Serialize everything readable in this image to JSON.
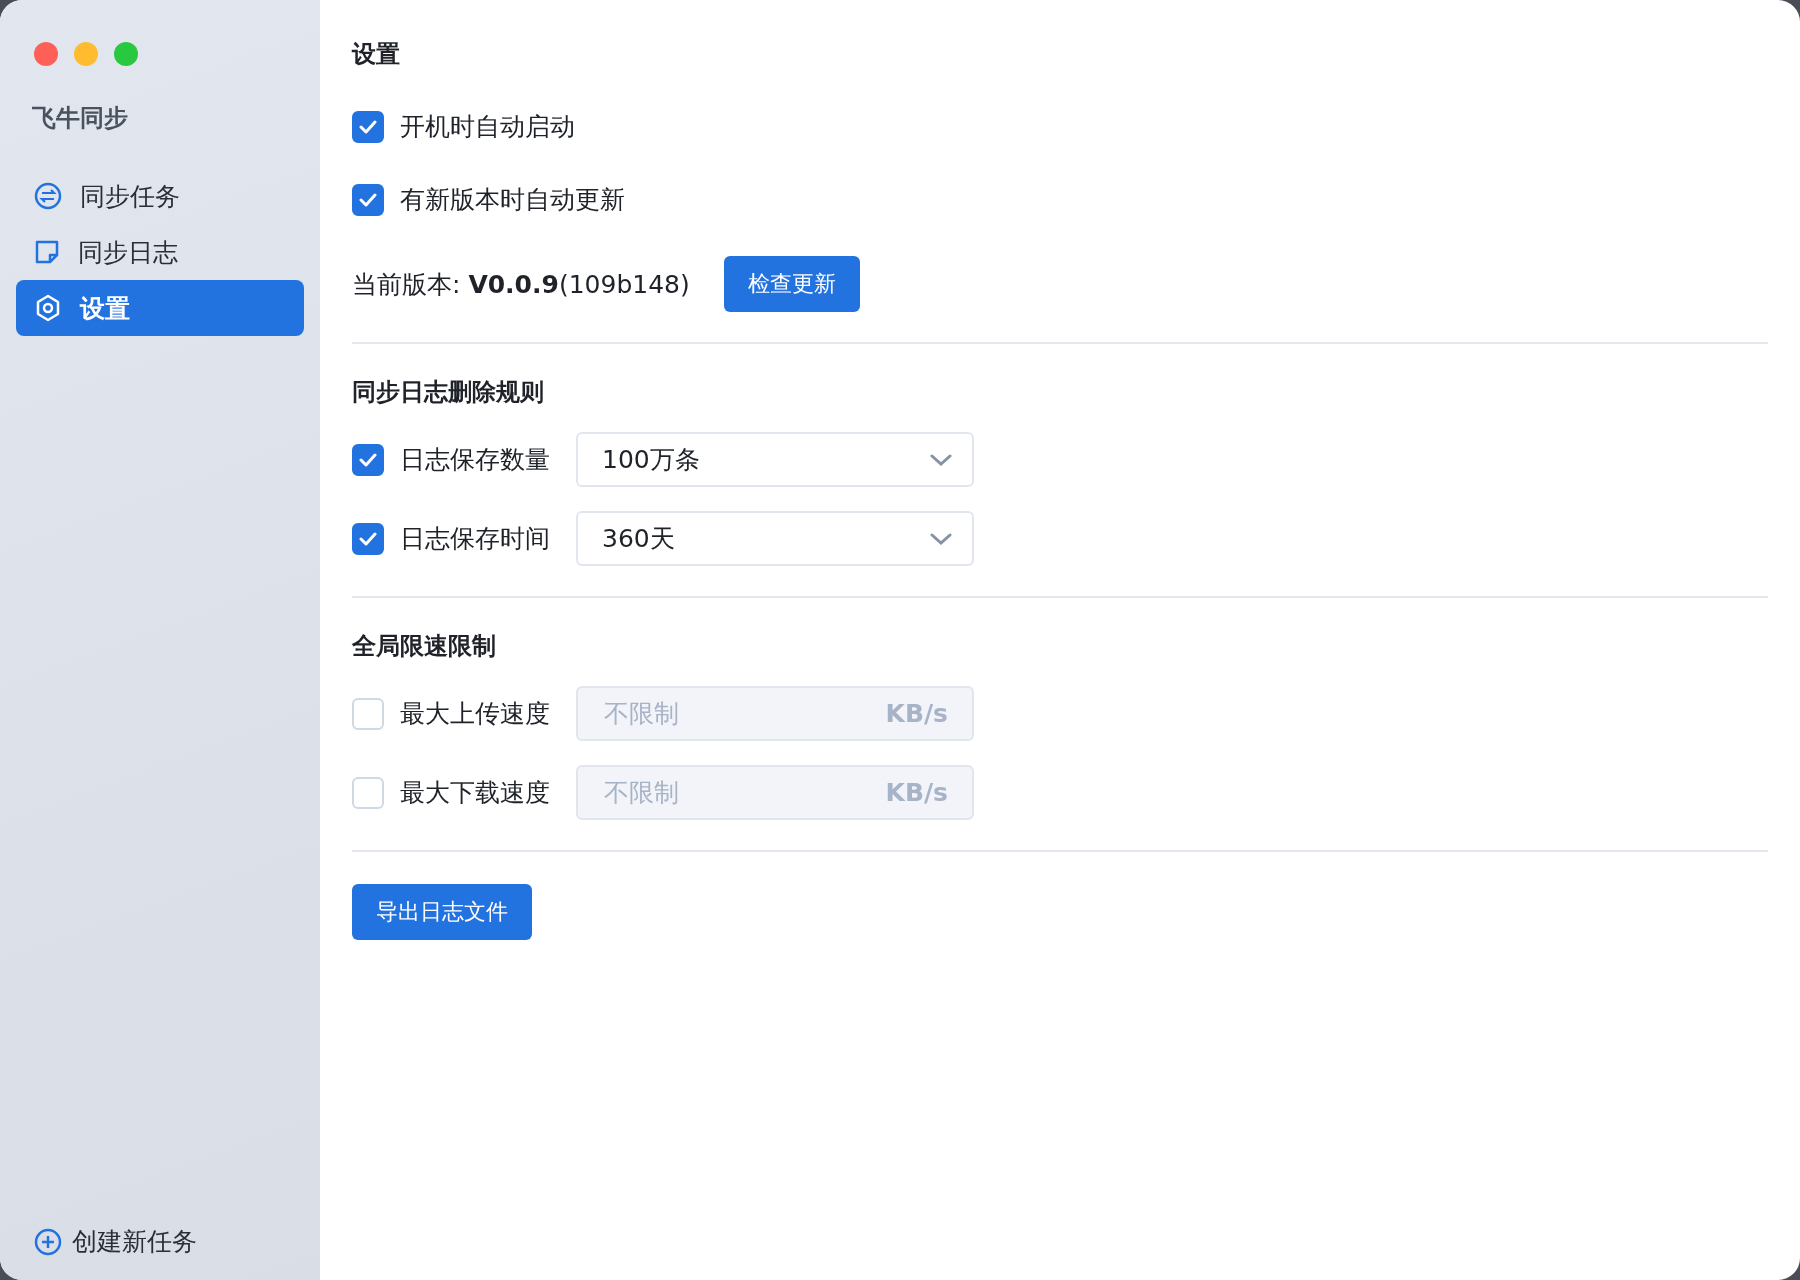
{
  "sidebar": {
    "app_name": "飞牛同步",
    "items": [
      {
        "label": "同步任务",
        "selected": false
      },
      {
        "label": "同步日志",
        "selected": false
      },
      {
        "label": "设置",
        "selected": true
      }
    ],
    "footer_button": "创建新任务"
  },
  "main": {
    "title": "设置",
    "general": [
      {
        "label": "开机时自动启动",
        "checked": true
      },
      {
        "label": "有新版本时自动更新",
        "checked": true
      }
    ],
    "version": "当前版本: **V0.0.9**(109b148)",
    "check_update_button": "检查更新",
    "log_rules": {
      "heading": "同步日志删除规则",
      "rows": [
        {
          "label": "日志保存数量",
          "checked": true,
          "value": "100万条"
        },
        {
          "label": "日志保存时间",
          "checked": true,
          "value": "360天"
        }
      ]
    },
    "speed_limits": {
      "heading": "全局限速限制",
      "rows": [
        {
          "label": "最大上传速度",
          "checked": false,
          "placeholder": "不限制",
          "unit": "KB/s"
        },
        {
          "label": "最大下载速度",
          "checked": false,
          "placeholder": "不限制",
          "unit": "KB/s"
        }
      ]
    },
    "export_button": "导出日志文件"
  }
}
